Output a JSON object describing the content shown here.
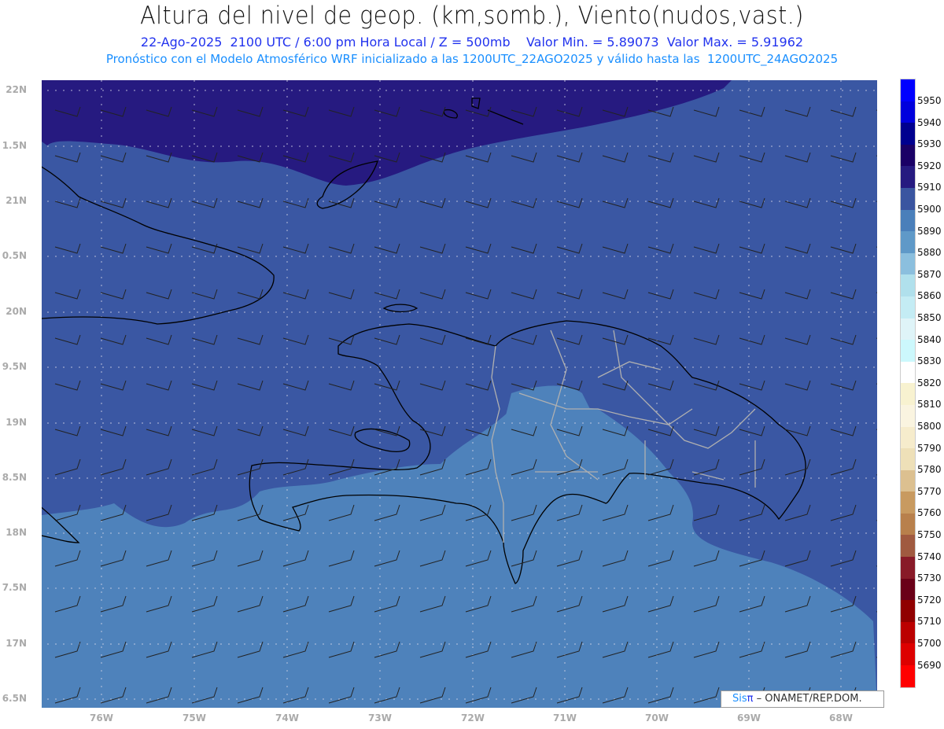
{
  "header": {
    "title": "Altura del nivel de geop. (km,somb.), Viento(nudos,vast.)",
    "subtitle": "22-Ago-2025  2100 UTC / 6:00 pm Hora Local / Z = 500mb    Valor Min. = 5.89073  Valor Max. = 5.91962",
    "forecast_line": "Pronóstico con el Modelo Atmosférico WRF inicializado a las 1200UTC_22AGO2025 y válido hasta las  1200UTC_24AGO2025"
  },
  "axes": {
    "lat_labels": [
      "22N",
      "1.5N",
      "21N",
      "0.5N",
      "20N",
      "9.5N",
      "19N",
      "8.5N",
      "18N",
      "7.5N",
      "17N",
      "6.5N"
    ],
    "lon_labels": [
      "76W",
      "75W",
      "74W",
      "73W",
      "72W",
      "71W",
      "70W",
      "69W",
      "68W"
    ]
  },
  "colorbar": {
    "labels": [
      "5950",
      "5940",
      "5930",
      "5920",
      "5910",
      "5900",
      "5890",
      "5880",
      "5870",
      "5860",
      "5850",
      "5840",
      "5830",
      "5820",
      "5810",
      "5800",
      "5790",
      "5780",
      "5770",
      "5760",
      "5750",
      "5740",
      "5730",
      "5720",
      "5710",
      "5700",
      "5690"
    ],
    "colors": [
      "#0000ff",
      "#0000dd",
      "#00008f",
      "#1a0066",
      "#261a80",
      "#3a55a0",
      "#4a7fba",
      "#5f99c8",
      "#8bbfde",
      "#b0e0ec",
      "#c4ecf4",
      "#dff4f8",
      "#ccf8fc",
      "#ffffff",
      "#f8f2d0",
      "#faf4e0",
      "#f6eccc",
      "#eee0b8",
      "#dcc090",
      "#c89a60",
      "#b8804c",
      "#a05a40",
      "#881a28",
      "#6a0018",
      "#900000",
      "#bb0000",
      "#dd0000",
      "#ff0000"
    ]
  },
  "map_colors": {
    "high": "#261a80",
    "mid": "#3a57a3",
    "low": "#4e82bb",
    "coast": "#000000",
    "borders": "#b0b0b0"
  },
  "credit": {
    "sis": "Sis",
    "pi": "π",
    "org": "– ONAMET/REP.DOM."
  }
}
